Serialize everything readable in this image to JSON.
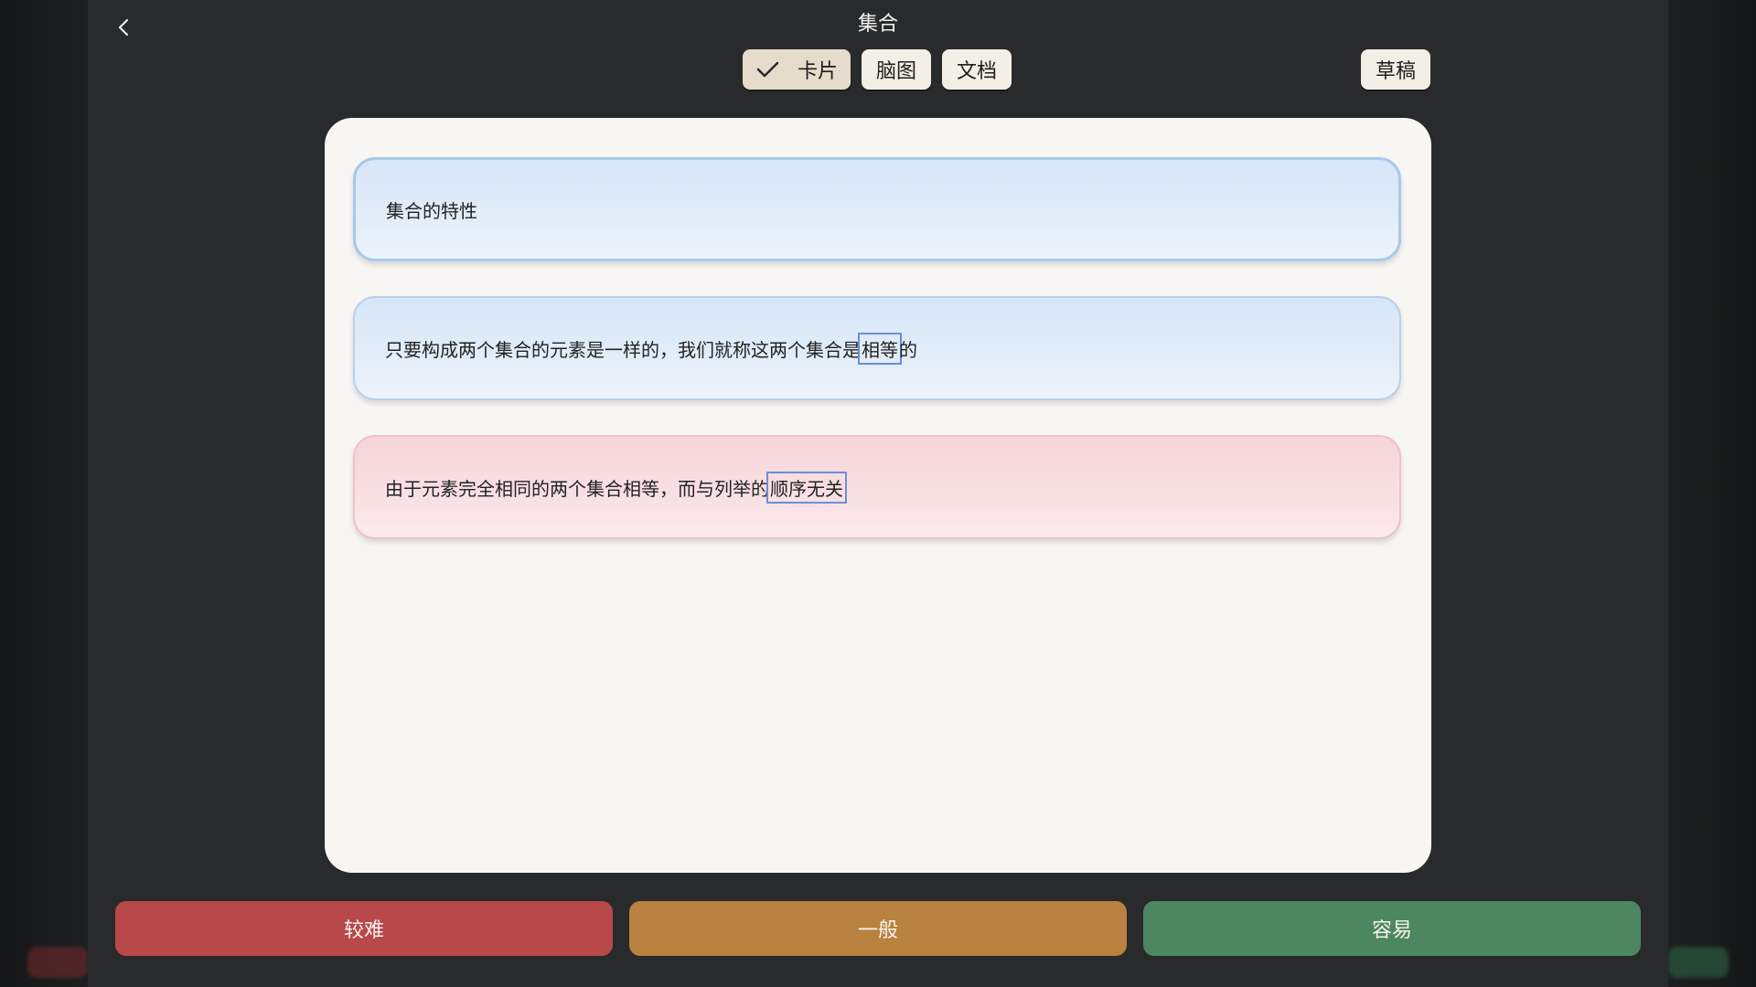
{
  "header": {
    "title": "集合",
    "back_icon": "chevron-left-icon"
  },
  "mode_tabs": [
    {
      "label": "卡片",
      "active": true,
      "icon": "check-icon"
    },
    {
      "label": "脑图",
      "active": false
    },
    {
      "label": "文档",
      "active": false
    }
  ],
  "draft_label": "草稿",
  "cards": [
    {
      "text": "集合的特性",
      "color": "blue"
    },
    {
      "before": "只要构成两个集合的元素是一样的，我们就称这两个集合是",
      "highlight": "相等",
      "after": "的",
      "color": "blue"
    },
    {
      "before": "由于元素完全相同的两个集合相等，而与列举的",
      "highlight": "顺序无关",
      "after": "",
      "color": "pink"
    }
  ],
  "rating": {
    "hard": "较难",
    "normal": "一般",
    "easy": "容易"
  },
  "colors": {
    "hard": "#b9484b",
    "normal": "#b98240",
    "easy": "#4d8760",
    "panel": "#f7f6f2",
    "highlight_border": "#6a8fd6"
  }
}
